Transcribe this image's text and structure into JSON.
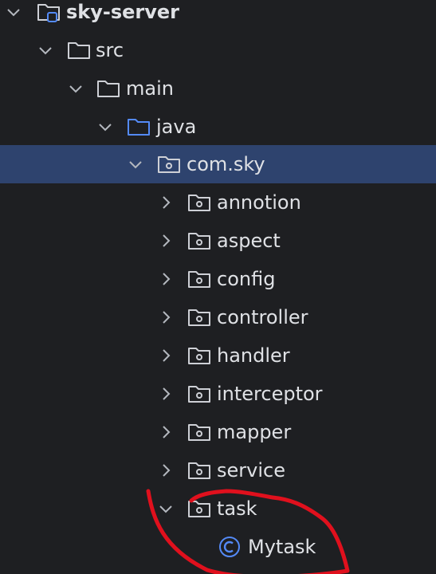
{
  "tree": {
    "project": {
      "label": "sky-server",
      "icon": "module-folder-icon"
    },
    "src": {
      "label": "src"
    },
    "main": {
      "label": "main"
    },
    "java": {
      "label": "java"
    },
    "com_sky": {
      "label": "com.sky"
    },
    "packages": [
      {
        "label": "annotion"
      },
      {
        "label": "aspect"
      },
      {
        "label": "config"
      },
      {
        "label": "controller"
      },
      {
        "label": "handler"
      },
      {
        "label": "interceptor"
      },
      {
        "label": "mapper"
      },
      {
        "label": "service"
      },
      {
        "label": "task"
      }
    ],
    "class_item": {
      "label": "Mytask",
      "icon": "java-class-icon"
    }
  },
  "colors": {
    "background": "#1e1f22",
    "selection": "#2e436e",
    "text": "#dfe1e5",
    "source_root_folder": "#548af7",
    "class_icon": "#548af7",
    "annotation_stroke": "#e0101d"
  }
}
